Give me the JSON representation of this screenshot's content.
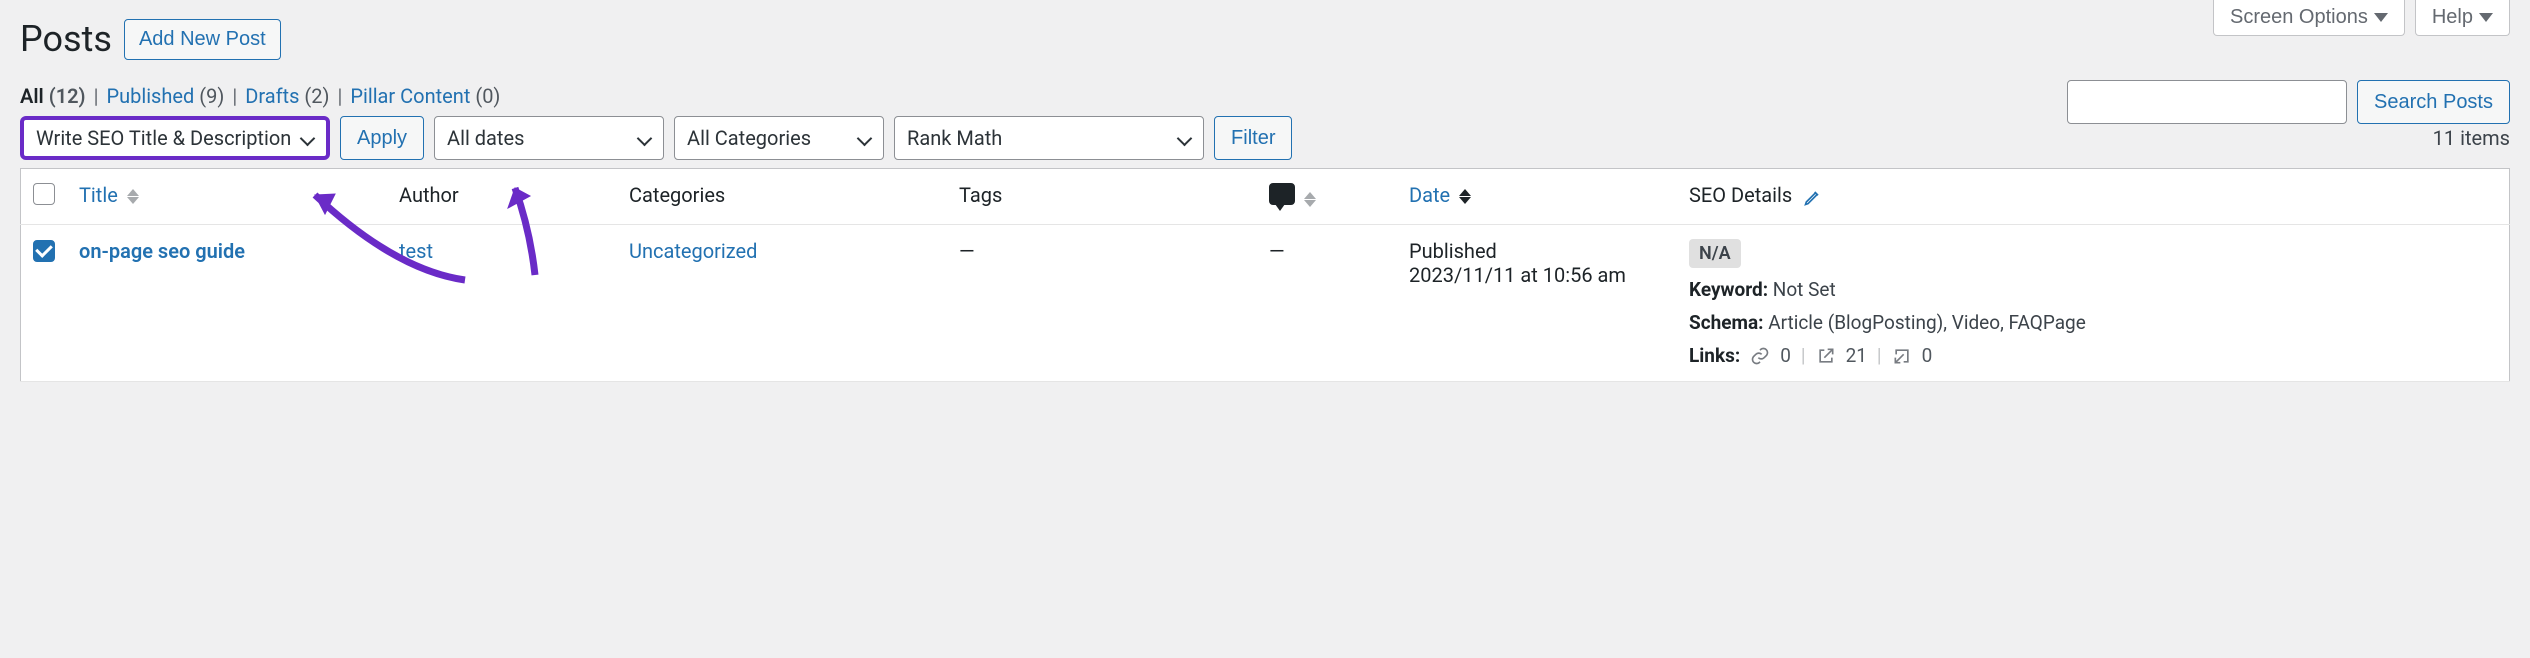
{
  "screen_meta": {
    "screen_options": "Screen Options",
    "help": "Help"
  },
  "heading": {
    "title": "Posts",
    "add_new": "Add New Post"
  },
  "filters": {
    "all_label": "All",
    "all_count": "(12)",
    "published_label": "Published",
    "published_count": "(9)",
    "drafts_label": "Drafts",
    "drafts_count": "(2)",
    "pillar_label": "Pillar Content",
    "pillar_count": "(0)"
  },
  "bulk": {
    "action_selected": "Write SEO Title & Description",
    "apply": "Apply"
  },
  "filter_selects": {
    "dates": "All dates",
    "categories": "All Categories",
    "rankmath": "Rank Math",
    "filter_btn": "Filter"
  },
  "search": {
    "value": "",
    "placeholder": "",
    "button": "Search Posts"
  },
  "items_count": "11 items",
  "columns": {
    "title": "Title",
    "author": "Author",
    "categories": "Categories",
    "tags": "Tags",
    "date": "Date",
    "seo": "SEO Details"
  },
  "row": {
    "title": "on-page seo guide",
    "author": "test",
    "category": "Uncategorized",
    "tags": "—",
    "comments": "—",
    "date_status": "Published",
    "date_value": "2023/11/11 at 10:56 am",
    "seo_badge": "N/A",
    "keyword_label": "Keyword:",
    "keyword_value": "Not Set",
    "schema_label": "Schema:",
    "schema_value": "Article (BlogPosting), Video, FAQPage",
    "links_label": "Links:",
    "links_internal": "0",
    "links_external": "21",
    "links_incoming": "0"
  }
}
